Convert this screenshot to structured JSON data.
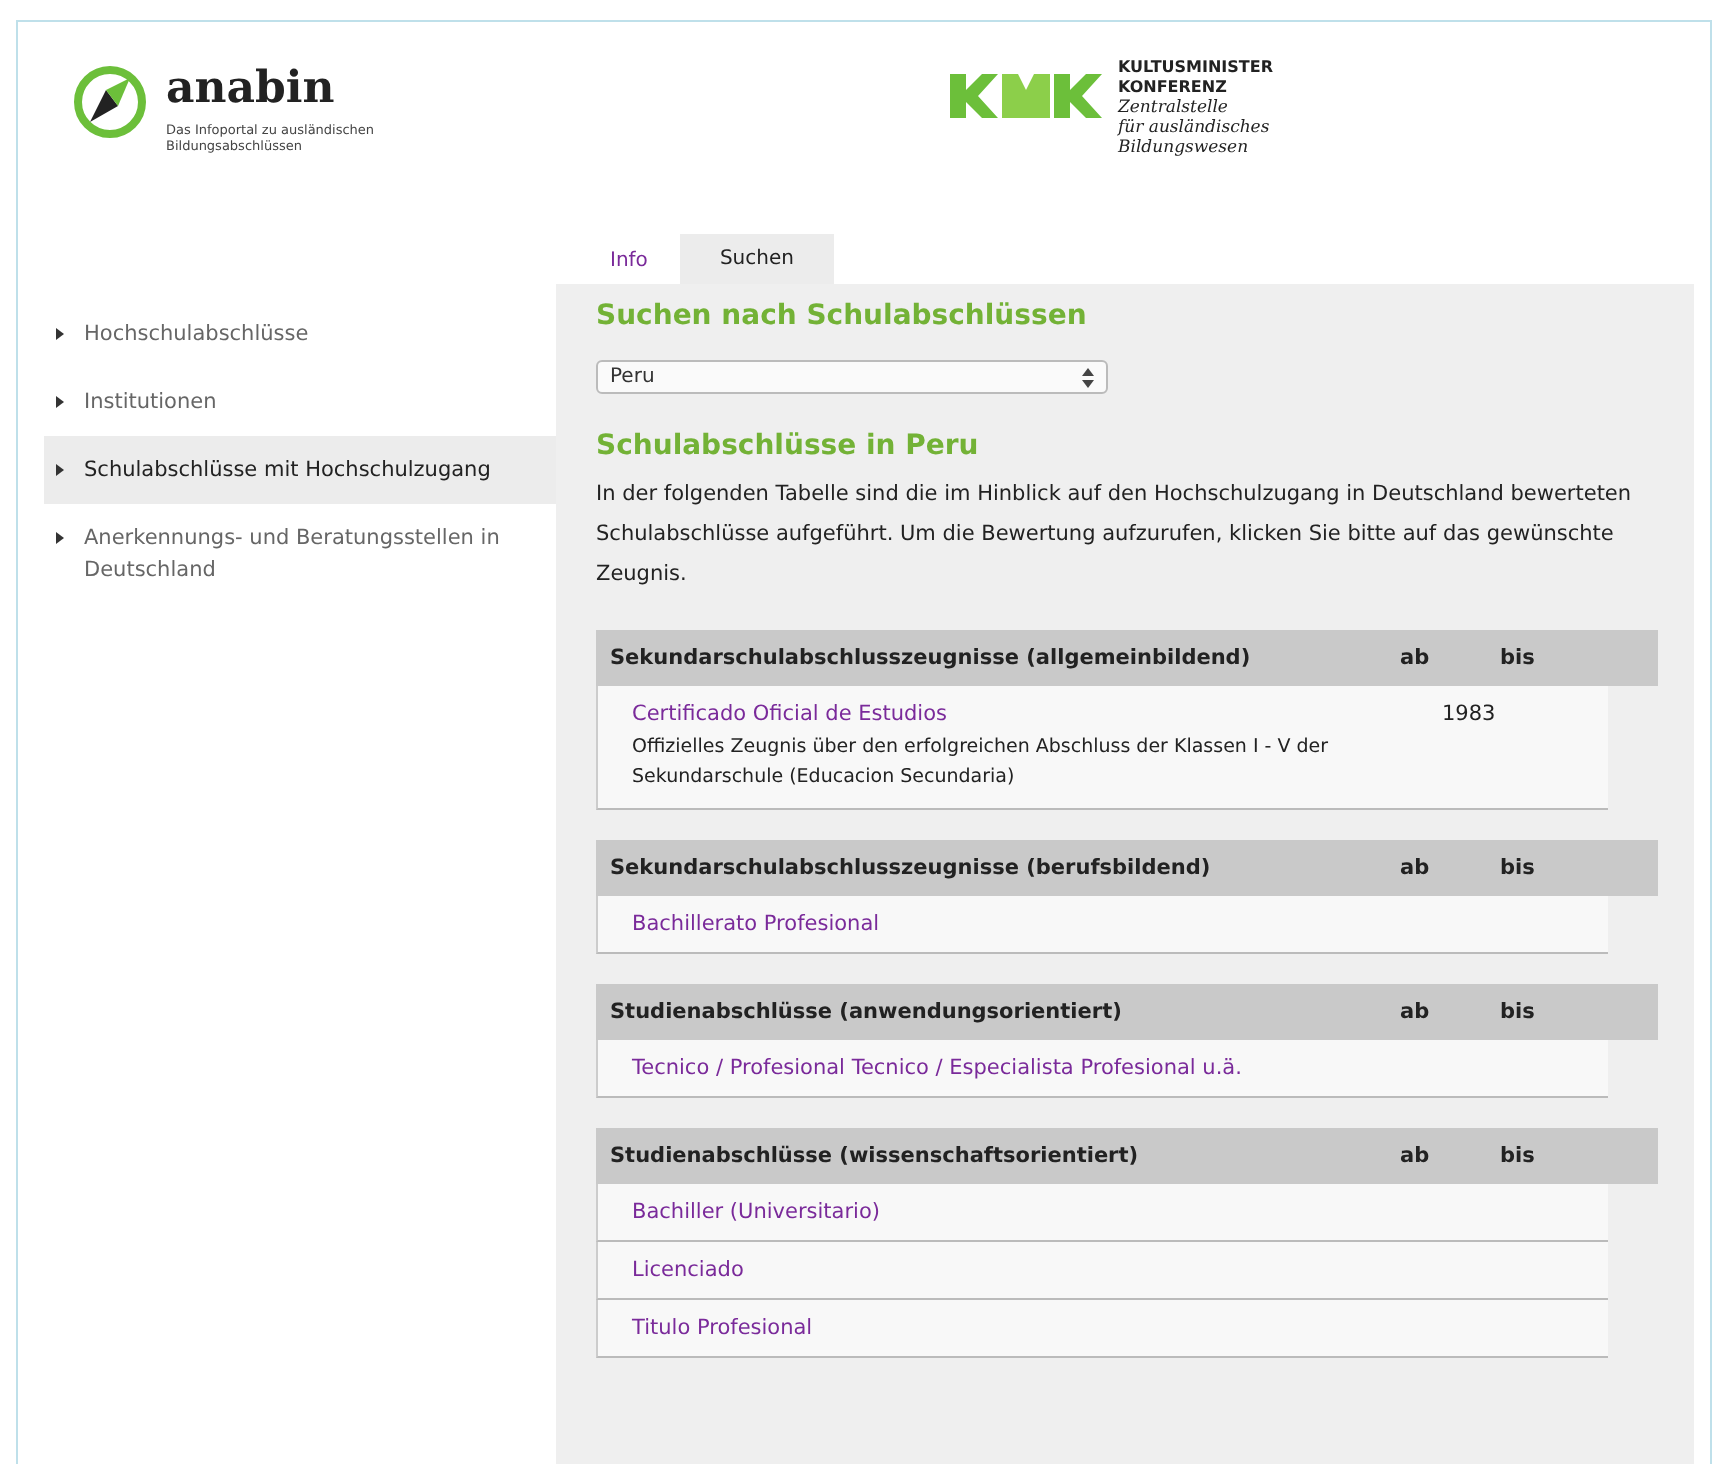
{
  "brand": {
    "name": "anabin",
    "tagline_lines": [
      "Das Infoportal zu ausländischen",
      "Bildungsabschlüssen"
    ]
  },
  "partner": {
    "lines_bold": [
      "KULTUSMINISTER",
      "KONFERENZ"
    ],
    "lines_italic": [
      "Zentralstelle",
      "für ausländisches",
      "Bildungswesen"
    ]
  },
  "tabs": [
    {
      "label": "Info",
      "selected": false
    },
    {
      "label": "Suchen",
      "selected": true
    }
  ],
  "sidebar": {
    "items": [
      {
        "label": "Hochschulabschlüsse",
        "selected": false
      },
      {
        "label": "Institutionen",
        "selected": false
      },
      {
        "label": "Schulabschlüsse mit Hochschulzugang",
        "selected": true
      },
      {
        "label": "Anerkennungs- und Beratungsstellen in Deutschland",
        "selected": false
      }
    ]
  },
  "search": {
    "title": "Suchen nach Schulabschlüssen",
    "country_select": "Peru"
  },
  "results": {
    "title": "Schulabschlüsse in Peru",
    "intro": "In der folgenden Tabelle sind die im Hinblick auf den Hochschulzugang in Deutschland bewerteten Schulabschlüsse aufgeführt. Um die Bewertung aufzurufen, klicken Sie bitte auf das gewünschte Zeugnis.",
    "sections": [
      {
        "heading": "Sekundarschulabschlusszeugnisse (allgemeinbildend)",
        "ab": "ab",
        "bis": "bis",
        "rows": [
          {
            "title": "Certificado Oficial de Estudios",
            "description": "Offizielles Zeugnis über den erfolgreichen Abschluss der Klassen I - V der Sekundarschule (Educacion Secundaria)",
            "ab": "1983"
          }
        ]
      },
      {
        "heading": "Sekundarschulabschlusszeugnisse (berufsbildend)",
        "ab": "ab",
        "bis": "bis",
        "rows": [
          {
            "title": "Bachillerato Profesional"
          }
        ]
      },
      {
        "heading": "Studienabschlüsse (anwendungsorientiert)",
        "ab": "ab",
        "bis": "bis",
        "rows": [
          {
            "title": "Tecnico / Profesional Tecnico / Especialista Profesional u.ä."
          }
        ]
      },
      {
        "heading": "Studienabschlüsse (wissenschaftsorientiert)",
        "ab": "ab",
        "bis": "bis",
        "rows": [
          {
            "title": "Bachiller (Universitario)"
          },
          {
            "title": "Licenciado"
          },
          {
            "title": "Titulo Profesional"
          }
        ]
      }
    ]
  }
}
